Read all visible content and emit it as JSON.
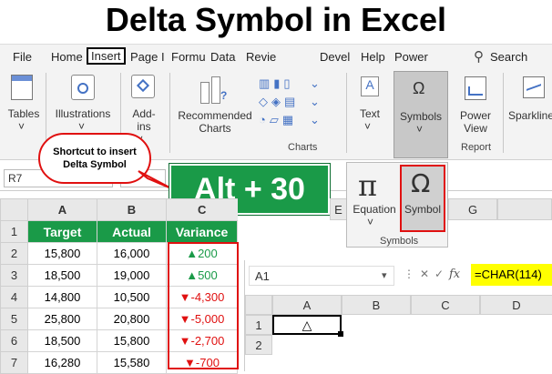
{
  "title": "Delta Symbol in Excel",
  "menu": [
    "File",
    "Home",
    "Insert",
    "Page I",
    "Formu",
    "Data",
    "Revie",
    "Devel",
    "Help",
    "Power"
  ],
  "search_label": "Search",
  "ribbon": {
    "tables": "Tables",
    "illustrations": "Illustrations",
    "addins_1": "Add-",
    "addins_2": "ins",
    "recommended_1": "Recommended",
    "recommended_2": "Charts",
    "charts_group": "Charts",
    "text": "Text",
    "symbols": "Symbols",
    "power_1": "Power",
    "power_2": "View",
    "report_group": "Report",
    "sparklines": "Sparkline"
  },
  "callout": {
    "line1": "Shortcut to insert",
    "line2": "Delta Symbol"
  },
  "shortcut": "Alt + 30",
  "namebox": "R7",
  "symbols_popup": {
    "equation": "Equation",
    "symbol": "Symbol",
    "group": "Symbols",
    "pi": "π",
    "omega": "Ω"
  },
  "sheet": {
    "columns": [
      "A",
      "B",
      "C"
    ],
    "headers": [
      "Target",
      "Actual",
      "Variance"
    ],
    "rows": [
      {
        "num": "1"
      },
      {
        "num": "2",
        "target": "15,800",
        "actual": "16,000",
        "arrow": "▲",
        "variance": "200",
        "dir": "up"
      },
      {
        "num": "3",
        "target": "18,500",
        "actual": "19,000",
        "arrow": "▲",
        "variance": "500",
        "dir": "up"
      },
      {
        "num": "4",
        "target": "14,800",
        "actual": "10,500",
        "arrow": "▼",
        "variance": "-4,300",
        "dir": "down"
      },
      {
        "num": "5",
        "target": "25,800",
        "actual": "20,800",
        "arrow": "▼",
        "variance": "-5,000",
        "dir": "down"
      },
      {
        "num": "6",
        "target": "18,500",
        "actual": "15,800",
        "arrow": "▼",
        "variance": "-2,700",
        "dir": "down"
      },
      {
        "num": "7",
        "target": "16,280",
        "actual": "15,580",
        "arrow": "▼",
        "variance": "-700",
        "dir": "down"
      }
    ],
    "extra_cols": [
      "E",
      "G"
    ]
  },
  "mini": {
    "namebox": "A1",
    "fx": "fx",
    "formula": "=CHAR(114)",
    "columns": [
      "A",
      "B",
      "C",
      "D"
    ],
    "rows": [
      "1",
      "2"
    ],
    "a1_value": "△"
  },
  "colors": {
    "green": "#1a9a48",
    "red": "#e01010",
    "yellow": "#ffff00"
  }
}
